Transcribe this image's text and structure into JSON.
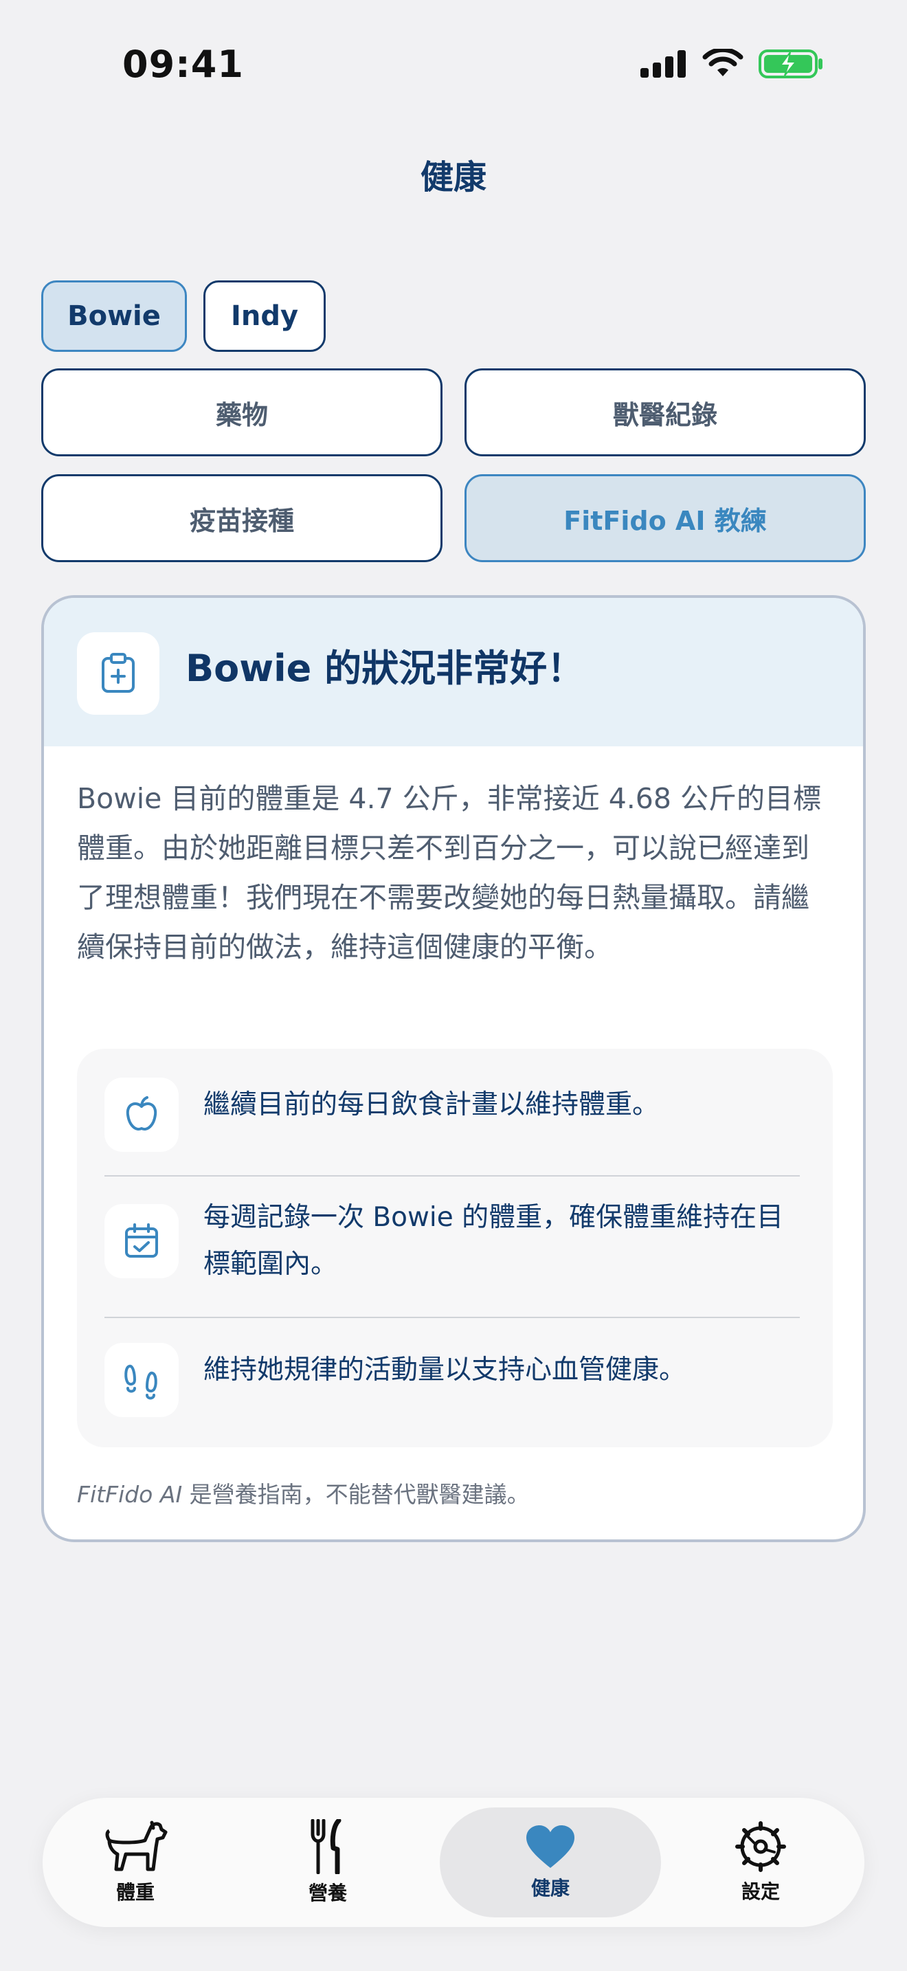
{
  "status": {
    "time": "09:41"
  },
  "page": {
    "title": "健康"
  },
  "pets": [
    {
      "name": "Bowie",
      "selected": true
    },
    {
      "name": "Indy",
      "selected": false
    }
  ],
  "sections": {
    "medication": "藥物",
    "vet_records": "獸醫紀錄",
    "vaccinations": "疫苗接種",
    "ai_coach": "FitFido AI 教練"
  },
  "card": {
    "icon": "clipboard-plus-icon",
    "title": "Bowie 的狀況非常好！",
    "body": "Bowie 目前的體重是 4.7 公斤，非常接近 4.68 公斤的目標體重。由於她距離目標只差不到百分之一，可以說已經達到了理想體重！我們現在不需要改變她的每日熱量攝取。請繼續保持目前的做法，維持這個健康的平衡。",
    "tips": [
      {
        "icon": "apple-icon",
        "text": "繼續目前的每日飲食計畫以維持體重。"
      },
      {
        "icon": "calendar-check-icon",
        "text": "每週記錄一次 Bowie 的體重，確保體重維持在目標範圍內。"
      },
      {
        "icon": "footprints-icon",
        "text": "維持她規律的活動量以支持心血管健康。"
      }
    ],
    "disclaimer_brand": "FitFido AI",
    "disclaimer_text": " 是營養指南，不能替代獸醫建議。"
  },
  "tabs": [
    {
      "label": "體重",
      "icon": "dog-icon"
    },
    {
      "label": "營養",
      "icon": "fork-knife-icon"
    },
    {
      "label": "健康",
      "icon": "heart-icon",
      "active": true
    },
    {
      "label": "設定",
      "icon": "gear-icon"
    }
  ],
  "colors": {
    "primary": "#123a6b",
    "accent": "#3a87bf",
    "battery": "#34c759"
  }
}
